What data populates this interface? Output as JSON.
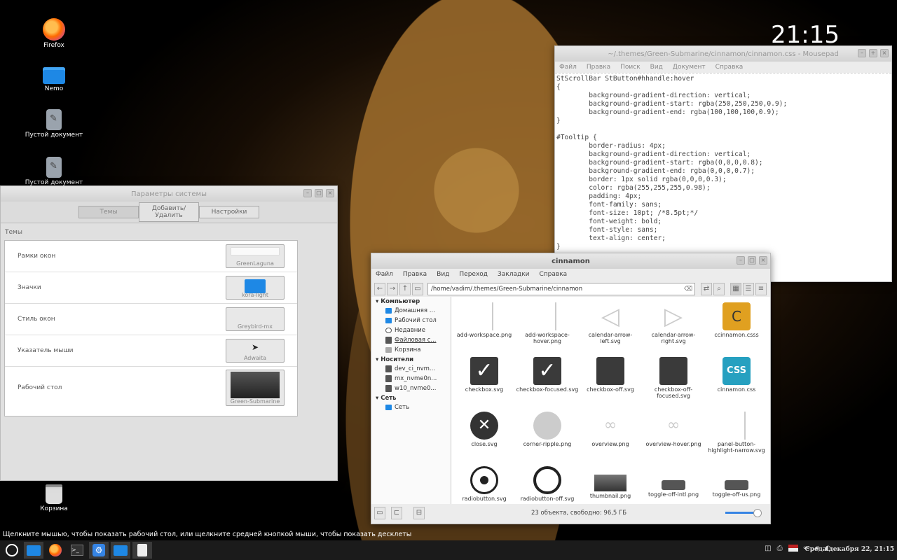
{
  "clock": "21:15",
  "desktop": {
    "icons": [
      {
        "label": "Firefox",
        "icon": "firefox-icon"
      },
      {
        "label": "Nemo",
        "icon": "folder-icon"
      },
      {
        "label": "Пустой документ",
        "icon": "document-icon"
      },
      {
        "label": "Пустой документ",
        "icon": "document-icon"
      },
      {
        "label": "Корзина",
        "icon": "trash-icon"
      }
    ]
  },
  "settings": {
    "title": "Параметры системы",
    "tabs": [
      "Темы",
      "Добавить/Удалить",
      "Настройки"
    ],
    "section": "Темы",
    "rows": [
      {
        "label": "Рамки окон",
        "value": "GreenLaguna"
      },
      {
        "label": "Значки",
        "value": "kora-light"
      },
      {
        "label": "Стиль окон",
        "value": "Greybird-mx"
      },
      {
        "label": "Указатель мыши",
        "value": "Adwaita"
      },
      {
        "label": "Рабочий стол",
        "value": "Green-Submarine"
      }
    ]
  },
  "mousepad": {
    "title": "~/.themes/Green-Submarine/cinnamon/cinnamon.css - Mousepad",
    "menu": [
      "Файл",
      "Правка",
      "Поиск",
      "Вид",
      "Документ",
      "Справка"
    ],
    "code": "StScrollBar StButton#hhandle:hover\n{\n        background-gradient-direction: vertical;\n        background-gradient-start: rgba(250,250,250,0.9);\n        background-gradient-end: rgba(100,100,100,0.9);\n}\n\n#Tooltip {\n        border-radius: 4px;\n        background-gradient-direction: vertical;\n        background-gradient-start: rgba(0,0,0,0.8);\n        background-gradient-end: rgba(0,0,0,0.7);\n        border: 1px solid rgba(0,0,0,0.3);\n        color: rgba(255,255,255,0.98);\n        padding: 4px;\n        font-family: sans;\n        font-size: 10pt; /*8.5pt;*/\n        font-weight: bold;\n        font-style: sans;\n        text-align: center;\n}"
  },
  "nemo": {
    "title": "cinnamon",
    "menu": [
      "Файл",
      "Правка",
      "Вид",
      "Переход",
      "Закладки",
      "Справка"
    ],
    "path": "/home/vadim/.themes/Green-Submarine/cinnamon",
    "sidebar": {
      "computer": "Компьютер",
      "computer_items": [
        "Домашняя ...",
        "Рабочий стол",
        "Недавние",
        "Файловая с...",
        "Корзина"
      ],
      "devices": "Носители",
      "device_items": [
        "dev_ci_nvm...",
        "mx_nvme0n...",
        "w10_nvme0..."
      ],
      "network": "Сеть",
      "network_items": [
        "Сеть"
      ]
    },
    "files": [
      {
        "name": "add-workspace.png",
        "kind": "blank"
      },
      {
        "name": "add-workspace-hover.png",
        "kind": "blank"
      },
      {
        "name": "calendar-arrow-left.svg",
        "kind": "tri-l"
      },
      {
        "name": "calendar-arrow-right.svg",
        "kind": "tri-r"
      },
      {
        "name": "ccinnamon.csss",
        "kind": "c"
      },
      {
        "name": "checkbox.svg",
        "kind": "check"
      },
      {
        "name": "checkbox-focused.svg",
        "kind": "check"
      },
      {
        "name": "checkbox-off.svg",
        "kind": "box"
      },
      {
        "name": "checkbox-off-focused.svg",
        "kind": "box"
      },
      {
        "name": "cinnamon.css",
        "kind": "css"
      },
      {
        "name": "close.svg",
        "kind": "close"
      },
      {
        "name": "corner-ripple.png",
        "kind": "ripple"
      },
      {
        "name": "overview.png",
        "kind": "ov"
      },
      {
        "name": "overview-hover.png",
        "kind": "ov"
      },
      {
        "name": "panel-button-highlight-narrow.svg",
        "kind": "blank"
      },
      {
        "name": "radiobutton.svg",
        "kind": "radio"
      },
      {
        "name": "radiobutton-off.svg",
        "kind": "radio-off"
      },
      {
        "name": "thumbnail.png",
        "kind": "thumb"
      },
      {
        "name": "toggle-off-intl.png",
        "kind": "toggle"
      },
      {
        "name": "toggle-off-us.png",
        "kind": "toggle"
      }
    ],
    "status": "23 объекта, свободно: 96,5 ГБ"
  },
  "hint": "Щелкните мышью, чтобы показать рабочий стол, или щелкните средней кнопкой мыши, чтобы показать десклеты",
  "taskbar": {
    "date": "Среда декабря 22, 21:15"
  }
}
